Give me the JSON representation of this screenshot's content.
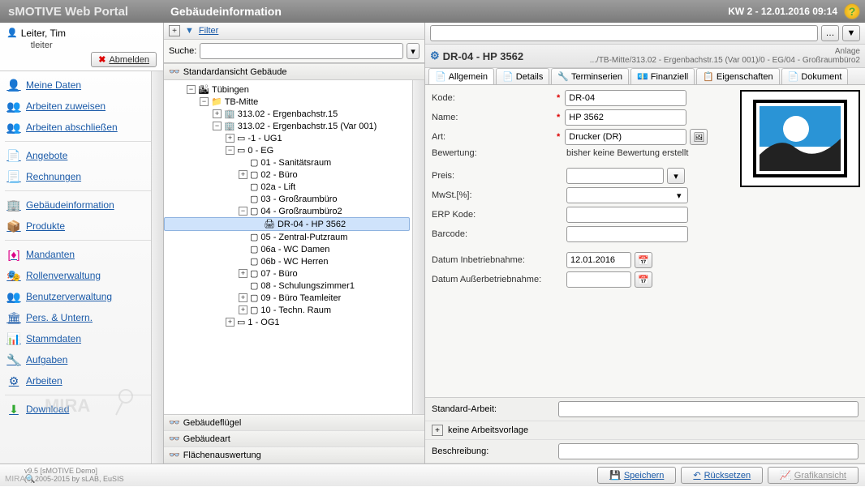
{
  "header": {
    "brand": "sMOTIVE Web Portal",
    "title": "Gebäudeinformation",
    "kw": "KW 2 - 12.01.2016 09:14"
  },
  "user": {
    "name": "Leiter, Tim",
    "login": "tleiter",
    "logout": "Abmelden"
  },
  "nav": {
    "items": [
      {
        "label": "Meine Daten"
      },
      {
        "label": "Arbeiten zuweisen"
      },
      {
        "label": "Arbeiten abschließen"
      },
      {
        "label": "Angebote"
      },
      {
        "label": "Rechnungen"
      },
      {
        "label": "Gebäudeinformation"
      },
      {
        "label": "Produkte"
      },
      {
        "label": "Mandanten"
      },
      {
        "label": "Rollenverwaltung"
      },
      {
        "label": "Benutzerverwaltung"
      },
      {
        "label": "Pers. & Untern."
      },
      {
        "label": "Stammdaten"
      },
      {
        "label": "Aufgaben"
      },
      {
        "label": "Arbeiten"
      },
      {
        "label": "Download"
      }
    ]
  },
  "mid": {
    "filter": "Filter",
    "suche": "Suche:",
    "tree_header": "Standardansicht Gebäude",
    "tree": {
      "root": "Tübingen",
      "l1": "TB-Mitte",
      "addr1": "313.02 - Ergenbachstr.15",
      "addr2": "313.02 - Ergenbachstr.15 (Var 001)",
      "ug1": "-1 - UG1",
      "eg": "0 - EG",
      "r01": "01 - Sanitätsraum",
      "r02": "02 - Büro",
      "r02a": "02a - Lift",
      "r03": "03 - Großraumbüro",
      "r04": "04 - Großraumbüro2",
      "dr04": "DR-04 - HP 3562",
      "r05": "05 - Zentral-Putzraum",
      "r06a": "06a - WC Damen",
      "r06b": "06b - WC Herren",
      "r07": "07 - Büro",
      "r08": "08 - Schulungszimmer1",
      "r09": "09 - Büro Teamleiter",
      "r10": "10 - Techn. Raum",
      "og1": "1 - OG1"
    },
    "footers": [
      "Gebäudeflügel",
      "Gebäudeart",
      "Flächenauswertung"
    ]
  },
  "right": {
    "title": "DR-04 - HP 3562",
    "type_label": "Anlage",
    "path": ".../TB-Mitte/313.02 - Ergenbachstr.15 (Var 001)/0 - EG/04 - Großraumbüro2",
    "tabs": [
      "Allgemein",
      "Details",
      "Terminserien",
      "Finanziell",
      "Eigenschaften",
      "Dokument"
    ],
    "form": {
      "kode_l": "Kode:",
      "kode": "DR-04",
      "name_l": "Name:",
      "name": "HP 3562",
      "art_l": "Art:",
      "art": "Drucker (DR)",
      "bew_l": "Bewertung:",
      "bew": "bisher keine Bewertung erstellt",
      "preis_l": "Preis:",
      "mwst_l": "MwSt.[%]:",
      "erp_l": "ERP Kode:",
      "barcode_l": "Barcode:",
      "di_l": "Datum Inbetriebnahme:",
      "di": "12.01.2016",
      "da_l": "Datum Außerbetriebnahme:",
      "std_l": "Standard-Arbeit:",
      "av_l": "keine Arbeitsvorlage",
      "beschr_l": "Beschreibung:"
    }
  },
  "bottom": {
    "save": "Speichern",
    "reset": "Rücksetzen",
    "grafik": "Grafikansicht",
    "ver1": "v9.5 [sMOTIVE Demo]",
    "ver2": "(c) 2005-2015 by sLAB, EuSIS"
  }
}
